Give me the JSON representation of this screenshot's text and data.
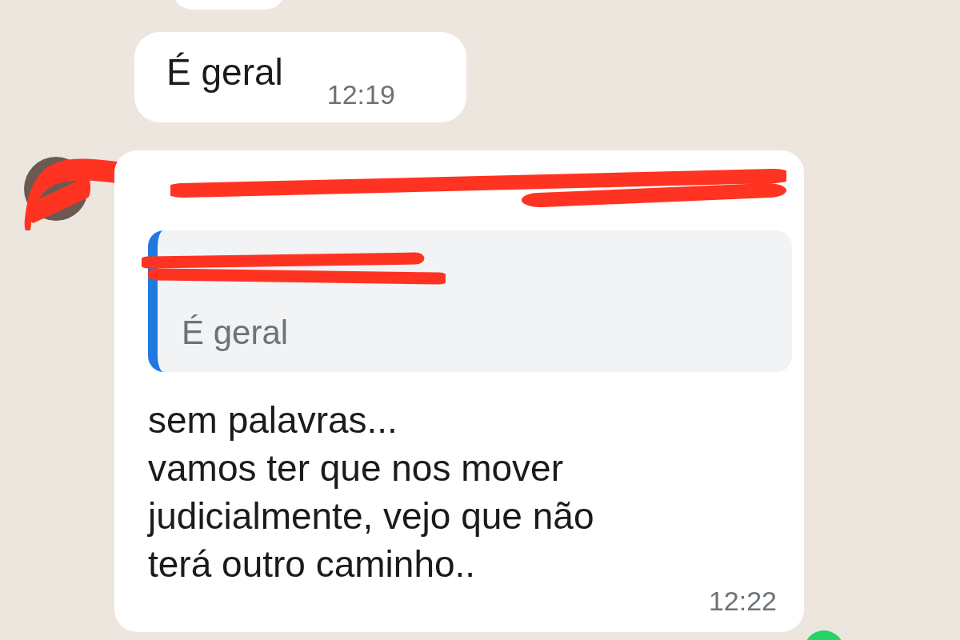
{
  "messages": [
    {
      "kind": "plain",
      "text": "É geral",
      "time": "12:19"
    },
    {
      "kind": "reply",
      "quote": {
        "text": "É geral"
      },
      "lines": [
        "sem palavras...",
        "vamos ter que nos mover",
        "judicialmente, vejo que não",
        "terá outro caminho.."
      ],
      "time": "12:22"
    }
  ]
}
